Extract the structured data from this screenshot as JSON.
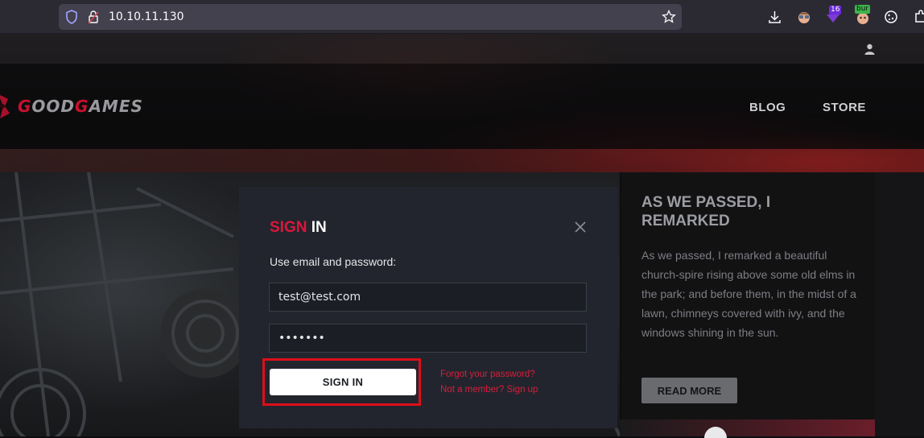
{
  "browser": {
    "url": "10.10.11.130",
    "extension_badges": {
      "ublock_count": "16",
      "burp_label": "bur"
    }
  },
  "site": {
    "logo": {
      "prefix_red": "G",
      "text1": "OOD",
      "mid_red": "G",
      "text2": "AMES"
    },
    "nav": {
      "blog": "BLOG",
      "store": "STORE"
    }
  },
  "modal": {
    "title_accent": "SIGN",
    "title_rest": " IN",
    "instruction": "Use email and password:",
    "email_value": "test@test.com",
    "password_value": "•••••••",
    "signin_button": "SIGN IN",
    "forgot_link": "Forgot your password?",
    "signup_link": "Not a member? Sign up"
  },
  "side_panel": {
    "title": "AS WE PASSED, I REMARKED",
    "body": "As we passed, I remarked a beautiful church-spire rising above some old elms in the park; and before them, in the midst of a lawn, chimneys covered with ivy, and the windows shining in the sun.",
    "button": "READ MORE"
  },
  "colors": {
    "accent_red": "#dd163b",
    "modal_bg": "#22252d",
    "highlight_outline": "#dd0f19"
  }
}
